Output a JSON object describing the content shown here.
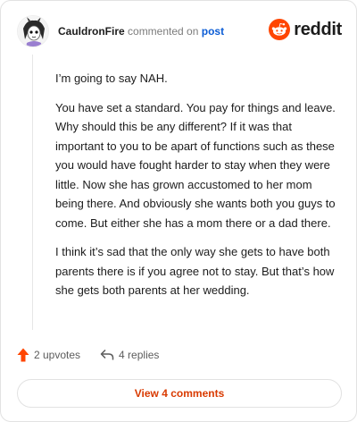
{
  "comment": {
    "username": "CauldronFire",
    "verb": "commented on",
    "post_link": "post",
    "paragraphs": [
      "I’m going to say NAH.",
      "You have set a standard. You pay for things and leave. Why should this be any different? If it was that important to you to be apart of functions such as these you would have fought harder to stay when they were little. Now she has grown accustomed to her mom being there. And obviously she wants both you guys to come. But either she has a mom there or a dad there.",
      "I think it’s sad that the only way she gets to have both parents there is if you agree not to stay. But that’s how she gets both parents at her wedding."
    ]
  },
  "brand": {
    "wordmark": "reddit",
    "icon": "reddit-logo-icon",
    "color": "#ff4500"
  },
  "actions": {
    "upvotes": "2 upvotes",
    "replies": "4 replies",
    "upvote_color": "#ff4500"
  },
  "footer": {
    "view_comments": "View 4 comments",
    "accent": "#d93a00"
  }
}
